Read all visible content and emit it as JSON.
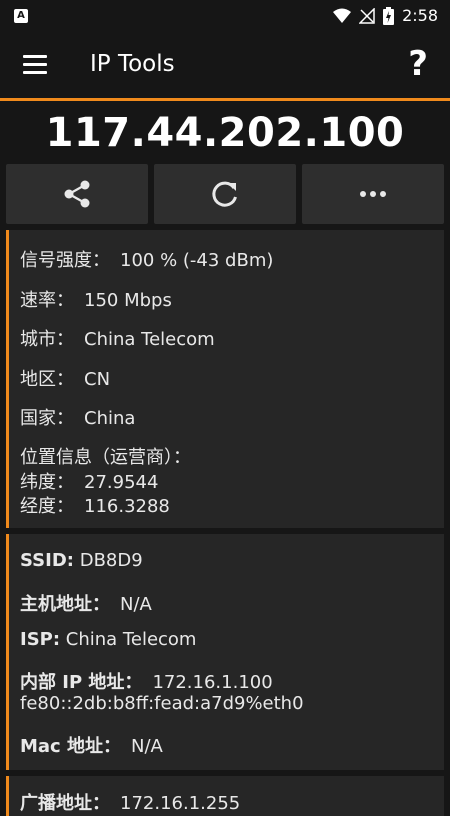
{
  "status": {
    "time": "2:58",
    "app_icon": "A"
  },
  "appbar": {
    "title": "IP Tools",
    "help": "?"
  },
  "ip": "117.44.202.100",
  "actions": [
    {
      "name": "share-button",
      "icon": "share-icon"
    },
    {
      "name": "refresh-button",
      "icon": "refresh-icon"
    },
    {
      "name": "more-button",
      "icon": "more-icon"
    }
  ],
  "card1": {
    "signal_label": "信号强度：",
    "signal_value": "100 % (-43 dBm)",
    "rate_label": "速率：",
    "rate_value": "150 Mbps",
    "city_label": "城市：",
    "city_value": "China Telecom",
    "region_label": "地区：",
    "region_value": "CN",
    "country_label": "国家：",
    "country_value": "China",
    "location_label": "位置信息（运营商）：",
    "lat_label": "纬度：",
    "lat_value": "27.9544",
    "lon_label": "经度：",
    "lon_value": "116.3288"
  },
  "card2": {
    "ssid_label": "SSID:",
    "ssid_value": "DB8D9",
    "host_label": "主机地址：",
    "host_value": "N/A",
    "isp_label": "ISP:",
    "isp_value": "China Telecom",
    "internal_ip_label": "内部 IP 地址：",
    "internal_ip_value": "172.16.1.100",
    "ipv6_value": "fe80::2db:b8ff:fead:a7d9%eth0",
    "mac_label": "Mac 地址：",
    "mac_value": "N/A"
  },
  "card3": {
    "broadcast_label": "广播地址：",
    "broadcast_value": "172.16.1.255"
  }
}
